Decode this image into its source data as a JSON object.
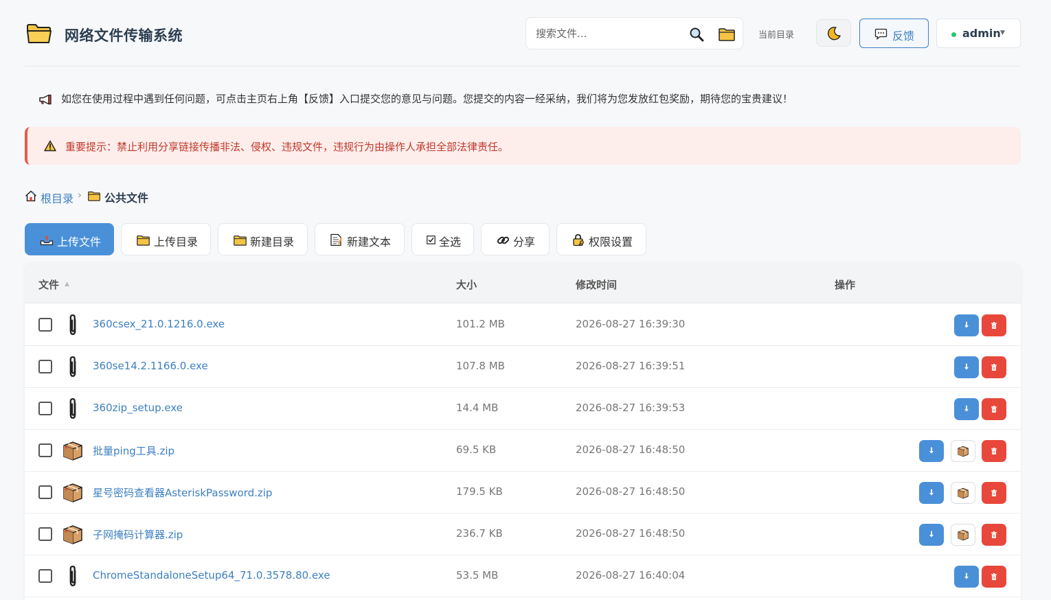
{
  "header": {
    "title": "网络文件传输系统",
    "search_placeholder": "搜索文件...",
    "current_dir_label": "当前目录",
    "feedback_label": "反馈",
    "username": "admin"
  },
  "notice": {
    "text": "如您在使用过程中遇到任何问题，可点击主页右上角【反馈】入口提交您的意见与问题。您提交的内容一经采纳，我们将为您发放红包奖励，期待您的宝贵建议！"
  },
  "warning": {
    "text": "重要提示：禁止利用分享链接传播非法、侵权、违规文件，违规行为由操作人承担全部法律责任。"
  },
  "breadcrumb": {
    "root": "根目录",
    "separator": "›",
    "current": "公共文件"
  },
  "toolbar": {
    "upload_file": "上传文件",
    "upload_dir": "上传目录",
    "new_dir": "新建目录",
    "new_text": "新建文本",
    "select_all": "全选",
    "share": "分享",
    "permissions": "权限设置"
  },
  "table": {
    "columns": {
      "name": "文件",
      "size": "大小",
      "modified": "修改时间",
      "actions": "操作"
    },
    "sort_indicator": "▲",
    "rows": [
      {
        "name": "360csex_21.0.1216.0.exe",
        "size": "101.2 MB",
        "modified": "2026-08-27 16:39:30",
        "type": "exe"
      },
      {
        "name": "360se14.2.1166.0.exe",
        "size": "107.8 MB",
        "modified": "2026-08-27 16:39:51",
        "type": "exe"
      },
      {
        "name": "360zip_setup.exe",
        "size": "14.4 MB",
        "modified": "2026-08-27 16:39:53",
        "type": "exe"
      },
      {
        "name": "批量ping工具.zip",
        "size": "69.5 KB",
        "modified": "2026-08-27 16:48:50",
        "type": "zip"
      },
      {
        "name": "星号密码查看器AsteriskPassword.zip",
        "size": "179.5 KB",
        "modified": "2026-08-27 16:48:50",
        "type": "zip"
      },
      {
        "name": "子网掩码计算器.zip",
        "size": "236.7 KB",
        "modified": "2026-08-27 16:48:50",
        "type": "zip"
      },
      {
        "name": "ChromeStandaloneSetup64_71.0.3578.80.exe",
        "size": "53.5 MB",
        "modified": "2026-08-27 16:40:04",
        "type": "exe"
      }
    ]
  },
  "colors": {
    "primary": "#4a90d9",
    "link": "#3d7fc1",
    "danger": "#e8483c",
    "warning_bg": "#fdeeec",
    "warning_text": "#c0392b",
    "online": "#28c76f"
  }
}
